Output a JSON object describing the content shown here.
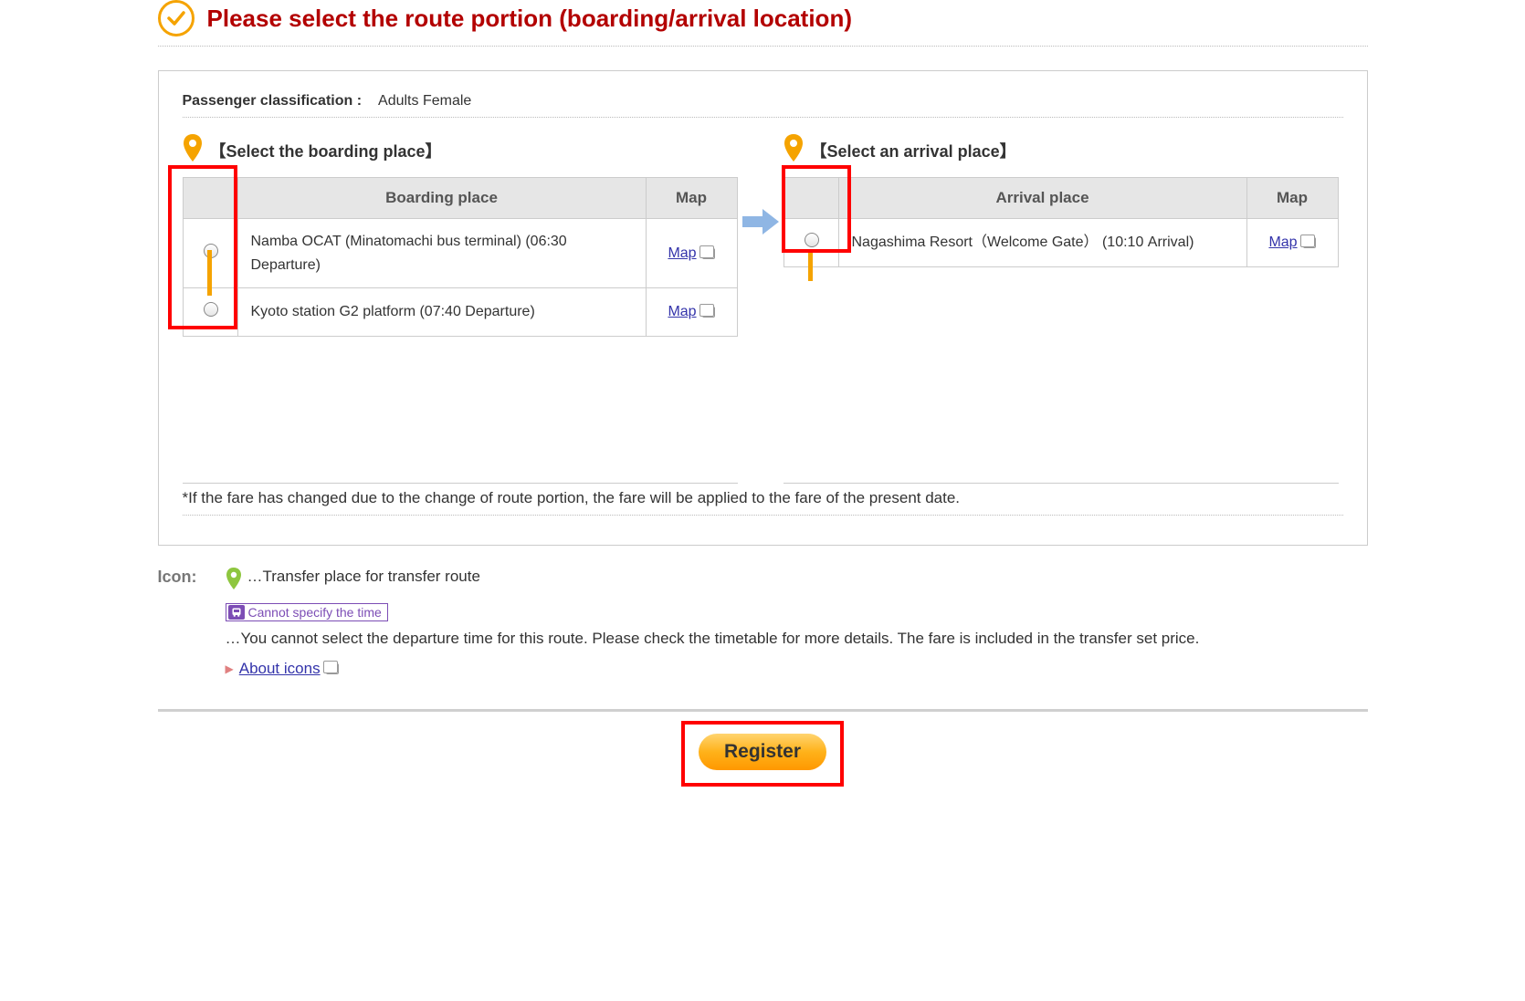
{
  "page_title": "Please select the route portion (boarding/arrival location)",
  "passenger_label": "Passenger classification :",
  "passenger_value": "Adults Female",
  "boarding": {
    "heading": "【Select the boarding place】",
    "col_place": "Boarding place",
    "col_map": "Map",
    "rows": [
      {
        "text": "Namba OCAT (Minatomachi bus terminal) (06:30 Departure)",
        "map": "Map"
      },
      {
        "text": "Kyoto station G2 platform (07:40 Departure)",
        "map": "Map"
      }
    ]
  },
  "arrival": {
    "heading": "【Select an arrival place】",
    "col_place": "Arrival place",
    "col_map": "Map",
    "rows": [
      {
        "text": "Nagashima Resort（Welcome Gate） (10:10 Arrival)",
        "map": "Map"
      }
    ]
  },
  "fare_note": "*If the fare has changed due to the change of route portion, the fare will be applied to the fare of the present date.",
  "legend": {
    "label": "Icon:",
    "transfer": "…Transfer place for transfer route",
    "tag_text": "Cannot specify the time",
    "tag_desc": "…You cannot select the departure time for this route. Please check the timetable for more details. The fare is included in the transfer set price.",
    "about": "About icons"
  },
  "register_label": "Register"
}
